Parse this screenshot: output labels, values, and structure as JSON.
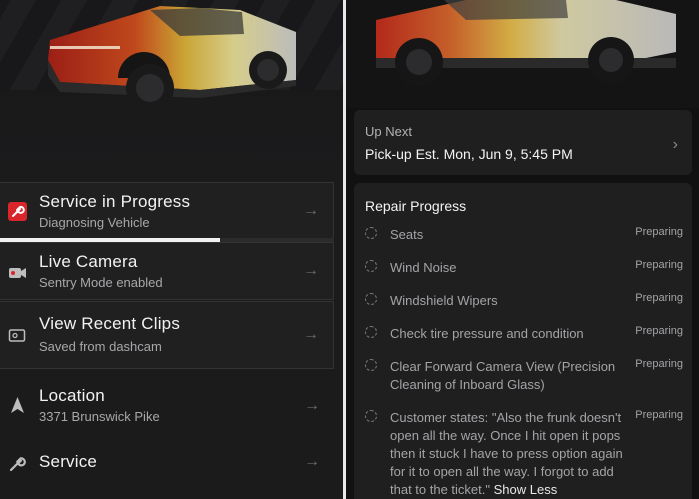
{
  "left_menu": {
    "service_in_progress": {
      "title": "Service in Progress",
      "subtitle": "Diagnosing Vehicle",
      "progress": 0.66
    },
    "live_camera": {
      "title": "Live Camera",
      "subtitle": "Sentry Mode enabled"
    },
    "recent_clips": {
      "title": "View Recent Clips",
      "subtitle": "Saved from dashcam"
    },
    "location": {
      "title": "Location",
      "subtitle": "3371 Brunswick Pike"
    },
    "service": {
      "title": "Service"
    },
    "arrow": "→"
  },
  "up_next": {
    "label": "Up Next",
    "value": "Pick-up Est. Mon, Jun 9, 5:45 PM",
    "chevron": "›"
  },
  "repair_progress": {
    "title": "Repair Progress",
    "status_label": "Preparing",
    "tasks": [
      {
        "text": "Seats",
        "status": "Preparing"
      },
      {
        "text": "Wind Noise",
        "status": "Preparing"
      },
      {
        "text": "Windshield Wipers",
        "status": "Preparing"
      },
      {
        "text": "Check tire pressure and condition",
        "status": "Preparing"
      },
      {
        "text": "Clear Forward Camera View (Precision Cleaning of Inboard Glass)",
        "status": "Preparing"
      },
      {
        "text": "Customer states: \"Also the frunk doesn't open all the way. Once I hit open it pops then it stuck I have to press option again for it to open all the way. I forgot to add that to the ticket.\"",
        "status": "Preparing",
        "action": "Show Less"
      }
    ]
  },
  "colors": {
    "accent_red": "#d8262b",
    "panel_bg": "#1b1b1c",
    "card_bg": "#1f1f20"
  },
  "icons": [
    "vehicle-image",
    "wrench-icon",
    "camera-icon",
    "clips-icon",
    "location-arrow-icon",
    "wrench-icon",
    "chevron-right-icon",
    "pending-circle-icon"
  ]
}
